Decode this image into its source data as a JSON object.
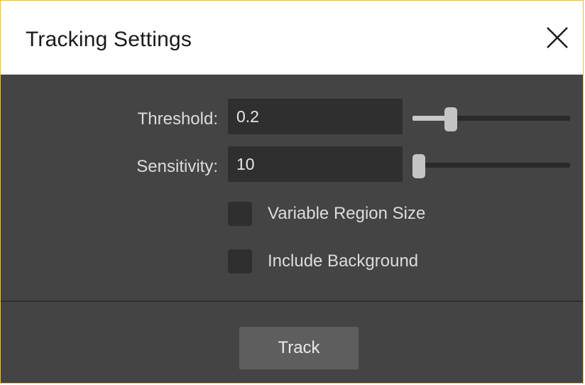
{
  "window": {
    "title": "Tracking Settings",
    "accent_border": "#e8b94a",
    "background": "#444444"
  },
  "close": {
    "icon": "close-icon"
  },
  "threshold": {
    "label": "Threshold:",
    "value": "0.2",
    "slider_level": 0.22
  },
  "sensitivity": {
    "label": "Sensitivity:",
    "value": "10",
    "slider_level": 0.0
  },
  "options": {
    "variable_region_size": {
      "label": "Variable Region Size",
      "checked": false
    },
    "include_background": {
      "label": "Include Background",
      "checked": false
    }
  },
  "footer": {
    "track_label": "Track"
  }
}
